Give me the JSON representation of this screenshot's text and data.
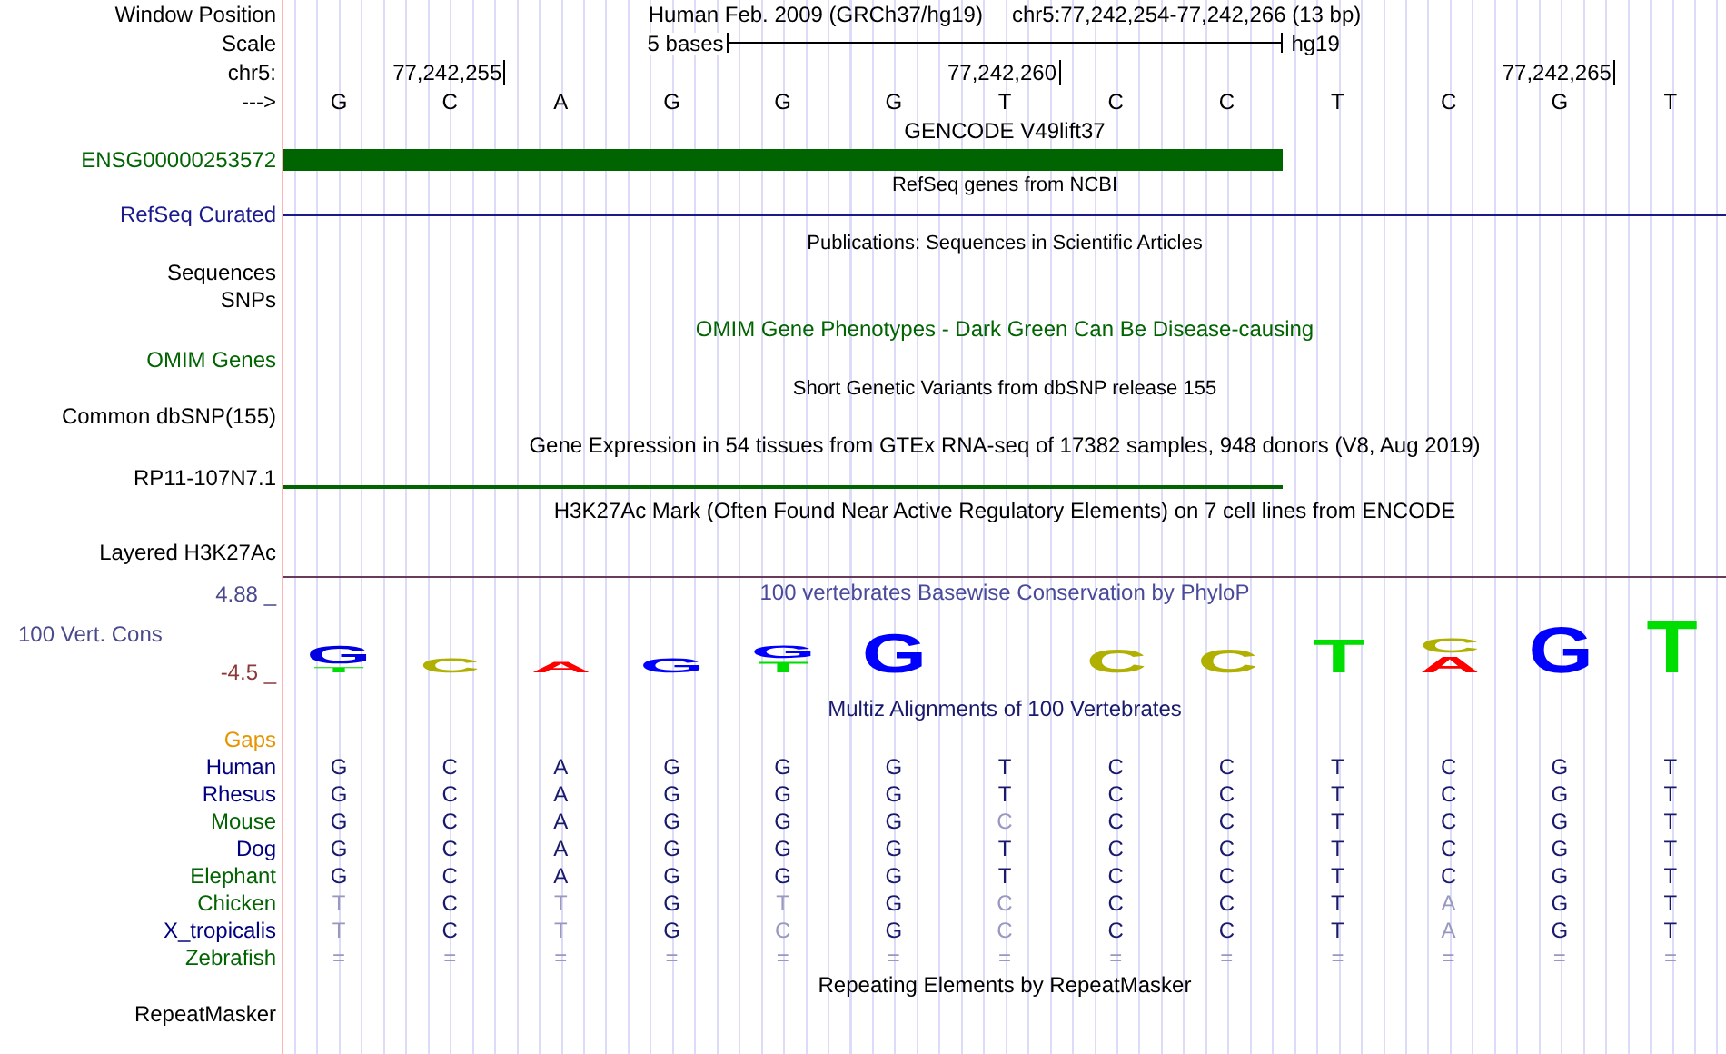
{
  "position": {
    "label": "Window Position",
    "assembly": "Human Feb. 2009 (GRCh37/hg19)",
    "range": "chr5:77,242,254-77,242,266 (13 bp)"
  },
  "scale": {
    "label": "Scale",
    "text": "5 bases",
    "db": "hg19"
  },
  "ruler": {
    "label": "chr5:",
    "ticks": [
      "77,242,255",
      "77,242,260",
      "77,242,265"
    ]
  },
  "strand": "--->",
  "bases": [
    "G",
    "C",
    "A",
    "G",
    "G",
    "G",
    "T",
    "C",
    "C",
    "T",
    "C",
    "G",
    "T"
  ],
  "gencode": {
    "title": "GENCODE V49lift37",
    "label": "ENSG00000253572"
  },
  "refseq": {
    "title": "RefSeq genes from NCBI",
    "label": "RefSeq Curated"
  },
  "publications": {
    "title": "Publications: Sequences in Scientific Articles"
  },
  "sequences": {
    "label": "Sequences"
  },
  "snps": {
    "label": "SNPs"
  },
  "omim": {
    "title": "OMIM Gene Phenotypes - Dark Green Can Be Disease-causing",
    "label": "OMIM Genes"
  },
  "dbsnp": {
    "title": "Short Genetic Variants from dbSNP release 155",
    "label": "Common dbSNP(155)"
  },
  "gtex": {
    "title": "Gene Expression in 54 tissues from GTEx RNA-seq of 17382 samples, 948 donors (V8, Aug 2019)",
    "label": "RP11-107N7.1"
  },
  "h3k27ac": {
    "title": "H3K27Ac Mark (Often Found Near Active Regulatory Elements) on 7 cell lines from ENCODE",
    "label": "Layered H3K27Ac"
  },
  "conservation": {
    "title": "100 vertebrates Basewise Conservation by PhyloP",
    "label": "100 Vert. Cons",
    "max": "4.88 _",
    "min": "-4.5 _",
    "logo": [
      {
        "letters": [
          {
            "base": "G",
            "color": "#0000e0"
          },
          {
            "base": "T",
            "color": "#00dd00"
          }
        ]
      },
      {
        "letters": [
          {
            "base": "C",
            "color": "#b0b000"
          }
        ]
      },
      {
        "letters": [
          {
            "base": "A",
            "color": "#ff0000"
          }
        ]
      },
      {
        "letters": [
          {
            "base": "G",
            "color": "#0000ff"
          }
        ]
      },
      {
        "letters": [
          {
            "base": "G",
            "color": "#0000ff"
          },
          {
            "base": "T",
            "color": "#00dd00"
          }
        ]
      },
      {
        "letters": [
          {
            "base": "G",
            "color": "#0000ff"
          }
        ]
      },
      {
        "letters": [
          {
            "base": "C",
            "color": "#b0b000"
          }
        ]
      },
      {
        "letters": [
          {
            "base": "C",
            "color": "#b0b000"
          }
        ]
      },
      {
        "letters": [
          {
            "base": "T",
            "color": "#00dd00"
          }
        ]
      },
      {
        "letters": [
          {
            "base": "C",
            "color": "#b0b000"
          },
          {
            "base": "A",
            "color": "#ff0000"
          }
        ]
      },
      {
        "letters": [
          {
            "base": "G",
            "color": "#0000ff"
          }
        ]
      },
      {
        "letters": [
          {
            "base": "T",
            "color": "#00dd00"
          }
        ]
      }
    ]
  },
  "multiz": {
    "title": "Multiz Alignments of 100 Vertebrates",
    "gaps": "Gaps",
    "species": [
      {
        "name": "Human",
        "color": "#000080",
        "cells": [
          {
            "base": "G",
            "faded": false
          },
          {
            "base": "C",
            "faded": false
          },
          {
            "base": "A",
            "faded": false
          },
          {
            "base": "G",
            "faded": false
          },
          {
            "base": "G",
            "faded": false
          },
          {
            "base": "G",
            "faded": false
          },
          {
            "base": "T",
            "faded": false
          },
          {
            "base": "C",
            "faded": false
          },
          {
            "base": "C",
            "faded": false
          },
          {
            "base": "T",
            "faded": false
          },
          {
            "base": "C",
            "faded": false
          },
          {
            "base": "G",
            "faded": false
          },
          {
            "base": "T",
            "faded": false
          }
        ]
      },
      {
        "name": "Rhesus",
        "color": "#000080",
        "cells": [
          {
            "base": "G",
            "faded": false
          },
          {
            "base": "C",
            "faded": false
          },
          {
            "base": "A",
            "faded": false
          },
          {
            "base": "G",
            "faded": false
          },
          {
            "base": "G",
            "faded": false
          },
          {
            "base": "G",
            "faded": false
          },
          {
            "base": "T",
            "faded": false
          },
          {
            "base": "C",
            "faded": false
          },
          {
            "base": "C",
            "faded": false
          },
          {
            "base": "T",
            "faded": false
          },
          {
            "base": "C",
            "faded": false
          },
          {
            "base": "G",
            "faded": false
          },
          {
            "base": "T",
            "faded": false
          }
        ]
      },
      {
        "name": "Mouse",
        "color": "#006400",
        "cells": [
          {
            "base": "G",
            "faded": false
          },
          {
            "base": "C",
            "faded": false
          },
          {
            "base": "A",
            "faded": false
          },
          {
            "base": "G",
            "faded": false
          },
          {
            "base": "G",
            "faded": false
          },
          {
            "base": "G",
            "faded": false
          },
          {
            "base": "C",
            "faded": true
          },
          {
            "base": "C",
            "faded": false
          },
          {
            "base": "C",
            "faded": false
          },
          {
            "base": "T",
            "faded": false
          },
          {
            "base": "C",
            "faded": false
          },
          {
            "base": "G",
            "faded": false
          },
          {
            "base": "T",
            "faded": false
          }
        ]
      },
      {
        "name": "Dog",
        "color": "#000080",
        "cells": [
          {
            "base": "G",
            "faded": false
          },
          {
            "base": "C",
            "faded": false
          },
          {
            "base": "A",
            "faded": false
          },
          {
            "base": "G",
            "faded": false
          },
          {
            "base": "G",
            "faded": false
          },
          {
            "base": "G",
            "faded": false
          },
          {
            "base": "T",
            "faded": false
          },
          {
            "base": "C",
            "faded": false
          },
          {
            "base": "C",
            "faded": false
          },
          {
            "base": "T",
            "faded": false
          },
          {
            "base": "C",
            "faded": false
          },
          {
            "base": "G",
            "faded": false
          },
          {
            "base": "T",
            "faded": false
          }
        ]
      },
      {
        "name": "Elephant",
        "color": "#006400",
        "cells": [
          {
            "base": "G",
            "faded": false
          },
          {
            "base": "C",
            "faded": false
          },
          {
            "base": "A",
            "faded": false
          },
          {
            "base": "G",
            "faded": false
          },
          {
            "base": "G",
            "faded": false
          },
          {
            "base": "G",
            "faded": false
          },
          {
            "base": "T",
            "faded": false
          },
          {
            "base": "C",
            "faded": false
          },
          {
            "base": "C",
            "faded": false
          },
          {
            "base": "T",
            "faded": false
          },
          {
            "base": "C",
            "faded": false
          },
          {
            "base": "G",
            "faded": false
          },
          {
            "base": "T",
            "faded": false
          }
        ]
      },
      {
        "name": "Chicken",
        "color": "#006400",
        "cells": [
          {
            "base": "T",
            "faded": true
          },
          {
            "base": "C",
            "faded": false
          },
          {
            "base": "T",
            "faded": true
          },
          {
            "base": "G",
            "faded": false
          },
          {
            "base": "T",
            "faded": true
          },
          {
            "base": "G",
            "faded": false
          },
          {
            "base": "C",
            "faded": true
          },
          {
            "base": "C",
            "faded": false
          },
          {
            "base": "C",
            "faded": false
          },
          {
            "base": "T",
            "faded": false
          },
          {
            "base": "A",
            "faded": true
          },
          {
            "base": "G",
            "faded": false
          },
          {
            "base": "T",
            "faded": false
          }
        ]
      },
      {
        "name": "X_tropicalis",
        "color": "#000080",
        "cells": [
          {
            "base": "T",
            "faded": true
          },
          {
            "base": "C",
            "faded": false
          },
          {
            "base": "T",
            "faded": true
          },
          {
            "base": "G",
            "faded": false
          },
          {
            "base": "C",
            "faded": true
          },
          {
            "base": "G",
            "faded": false
          },
          {
            "base": "C",
            "faded": true
          },
          {
            "base": "C",
            "faded": false
          },
          {
            "base": "C",
            "faded": false
          },
          {
            "base": "T",
            "faded": false
          },
          {
            "base": "A",
            "faded": true
          },
          {
            "base": "G",
            "faded": false
          },
          {
            "base": "T",
            "faded": false
          }
        ]
      },
      {
        "name": "Zebrafish",
        "color": "#006400",
        "cells": [
          {
            "base": "=",
            "faded": true
          },
          {
            "base": "=",
            "faded": true
          },
          {
            "base": "=",
            "faded": true
          },
          {
            "base": "=",
            "faded": true
          },
          {
            "base": "=",
            "faded": true
          },
          {
            "base": "=",
            "faded": true
          },
          {
            "base": "=",
            "faded": true
          },
          {
            "base": "=",
            "faded": true
          },
          {
            "base": "=",
            "faded": true
          },
          {
            "base": "=",
            "faded": true
          },
          {
            "base": "=",
            "faded": true
          },
          {
            "base": "=",
            "faded": true
          },
          {
            "base": "=",
            "faded": true
          }
        ]
      }
    ]
  },
  "repeatmasker": {
    "title": "Repeating Elements by RepeatMasker",
    "label": "RepeatMasker"
  }
}
